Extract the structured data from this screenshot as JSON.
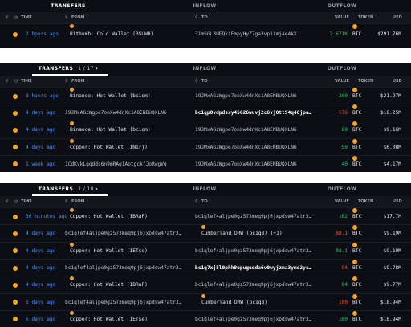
{
  "tabs": {
    "transfers": "TRANSFERS",
    "inflow": "INFLOW",
    "outflow": "OUTFLOW"
  },
  "headers": {
    "time": "TIME",
    "from": "FROM",
    "to": "TO",
    "value": "VALUE",
    "token": "TOKEN",
    "usd": "USD"
  },
  "icons": {
    "dot": "orange-dot-icon",
    "filter": "filter-icon",
    "clock": "clock-icon",
    "chevron": "chevron-down-icon",
    "sort": "sort-arrow-icon",
    "btc": "bitcoin-icon"
  },
  "colors": {
    "accent_blue": "#4f8ff7",
    "inflow_green": "#35c26c",
    "outflow_red": "#f0533d",
    "btc_orange": "#f5a524"
  },
  "panel1": {
    "page": "",
    "rows": [
      {
        "time": "2 hours ago",
        "from": "Bithumb: Cold Wallet (3SUWB)",
        "to": "31mSGL3UEQkiEmpyHyZ7ga3vp1imjAe4kX",
        "value": "2.671K",
        "token": "BTC",
        "usd": "$291.76M",
        "vc": "g"
      }
    ]
  },
  "panel2": {
    "page": "1 / 17",
    "rows": [
      {
        "time": "8 hours ago",
        "from": "Binance: Hot Wallet (bc1qm)",
        "to": "19JMxAGzWgpe7onXw4dnXc1A8ENBUQXLN6",
        "value": "200",
        "token": "BTC",
        "usd": "$21.97M",
        "vc": "g"
      },
      {
        "time": "4 days ago",
        "from": "19JMxAGzWgpe7onXw4dnXc1A8ENBUQXLN6",
        "to": "bc1qp0vdpdsxy45626wuvj2c6vj0tt94q40jpa…",
        "value": "176",
        "token": "BTC",
        "usd": "$18.25M",
        "vc": "r"
      },
      {
        "time": "4 days ago",
        "from": "Binance: Hot Wallet (bc1qm)",
        "to": "19JMxAGzWgpe7onXw4dnXc1A8ENBUQXLN6",
        "value": "89",
        "token": "BTC",
        "usd": "$9.16M",
        "vc": "g"
      },
      {
        "time": "4 days ago",
        "from": "Copper: Hot Wallet (1N1rj)",
        "to": "19JMxAGzWgpe7onXw4dnXc1A8ENBUQXLN6",
        "value": "59",
        "token": "BTC",
        "usd": "$6.08M",
        "vc": "g"
      },
      {
        "time": "1 week ago",
        "from": "1CdKvkLgqdds6n9mRAq1AotgckfJoRwgVq",
        "to": "19JMxAGzWgpe7onXw4dnXc1A8ENBUQXLN6",
        "value": "40",
        "token": "BTC",
        "usd": "$4.17M",
        "vc": "g"
      }
    ]
  },
  "panel3": {
    "page": "1 / 10",
    "rows": [
      {
        "time": "56 minutes ago",
        "from": "Copper: Hot Wallet (1BRaF)",
        "to": "bc1qlef4aljpe0gz573meq9pj6jxpdsw47atr3…",
        "value": "162",
        "token": "BTC",
        "usd": "$17.7M",
        "vc": "g"
      },
      {
        "time": "4 days ago",
        "from": "bc1qlef4aljpe0gz573meq9pj6jxpdsw47atr3…",
        "to": "Cumberland DRW (bc1q8) (+1)",
        "value": "88.1",
        "token": "BTC",
        "usd": "$9.19M",
        "vc": "r"
      },
      {
        "time": "4 days ago",
        "from": "Copper: Hot Wallet (1ETse)",
        "to": "bc1qlef4aljpe0gz573meq9pj6jxpdsw47atr3…",
        "value": "88.1",
        "token": "BTC",
        "usd": "$9.19M",
        "vc": "g"
      },
      {
        "time": "4 days ago",
        "from": "bc1qlef4aljpe0gz573meq9pj6jxpdsw47atr3…",
        "to": "bc1q7xj5l0phh9upuguedа6v0wyjzma3yms2yc…",
        "value": "94",
        "token": "BTC",
        "usd": "$9.78M",
        "vc": "r"
      },
      {
        "time": "4 days ago",
        "from": "Copper: Hot Wallet (1BRaF)",
        "to": "bc1qlef4aljpe0gz573meq9pj6jxpdsw47atr3…",
        "value": "94",
        "token": "BTC",
        "usd": "$9.77M",
        "vc": "g"
      },
      {
        "time": "5 days ago",
        "from": "bc1qlef4aljpe0gz573meq9pj6jxpdsw47atr3…",
        "to": "Cumberland DRW (bc1q8)",
        "value": "180",
        "token": "BTC",
        "usd": "$18.94M",
        "vc": "r"
      },
      {
        "time": "6 days ago",
        "from": "Copper: Hot Wallet (1ETse)",
        "to": "bc1qlef4aljpe0gz573meq9pj6jxpdsw47atr3…",
        "value": "180",
        "token": "BTC",
        "usd": "$18.94M",
        "vc": "g"
      }
    ]
  }
}
